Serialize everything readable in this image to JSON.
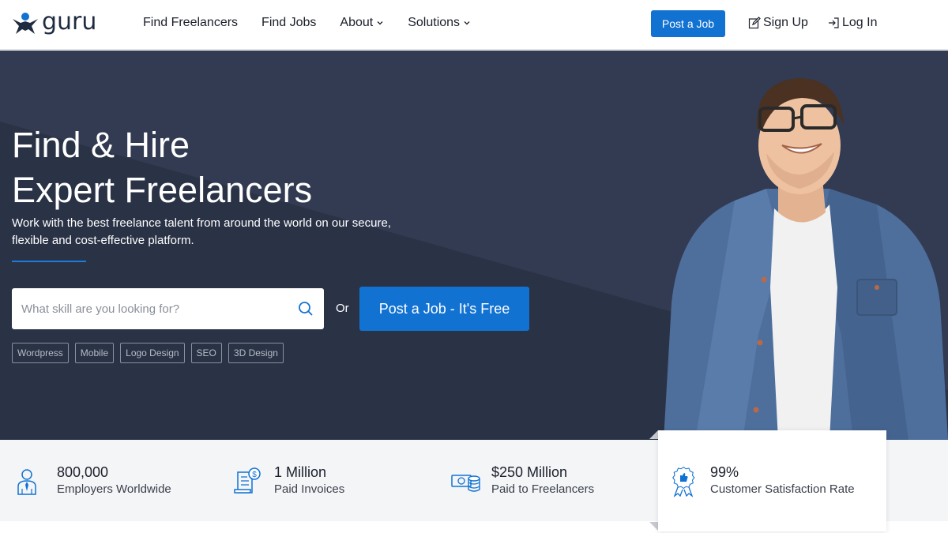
{
  "header": {
    "logo_text": "guru",
    "nav": [
      {
        "label": "Find Freelancers"
      },
      {
        "label": "Find Jobs"
      },
      {
        "label": "About"
      },
      {
        "label": "Solutions"
      }
    ],
    "post_job_label": "Post a Job",
    "sign_up_label": "Sign Up",
    "log_in_label": "Log In"
  },
  "hero": {
    "title_line1": "Find & Hire",
    "title_line2": "Expert Freelancers",
    "subtitle": "Work with the best freelance talent from around the world on our secure, flexible and cost-effective platform.",
    "search_placeholder": "What skill are you looking for?",
    "or_label": "Or",
    "post_job_free_label": "Post a Job - It's Free",
    "tags": [
      "Wordpress",
      "Mobile",
      "Logo Design",
      "SEO",
      "3D Design"
    ]
  },
  "stats": [
    {
      "value": "800,000",
      "label": "Employers Worldwide",
      "icon": "employer-icon"
    },
    {
      "value": "1 Million",
      "label": "Paid Invoices",
      "icon": "invoice-icon"
    },
    {
      "value": "$250 Million",
      "label": "Paid to Freelancers",
      "icon": "money-icon"
    },
    {
      "value": "99%",
      "label": "Customer Satisfaction Rate",
      "icon": "badge-icon"
    }
  ],
  "colors": {
    "brand_blue": "#1272d2",
    "hero_bg": "#2d3549",
    "stats_bg": "#f4f5f7"
  }
}
